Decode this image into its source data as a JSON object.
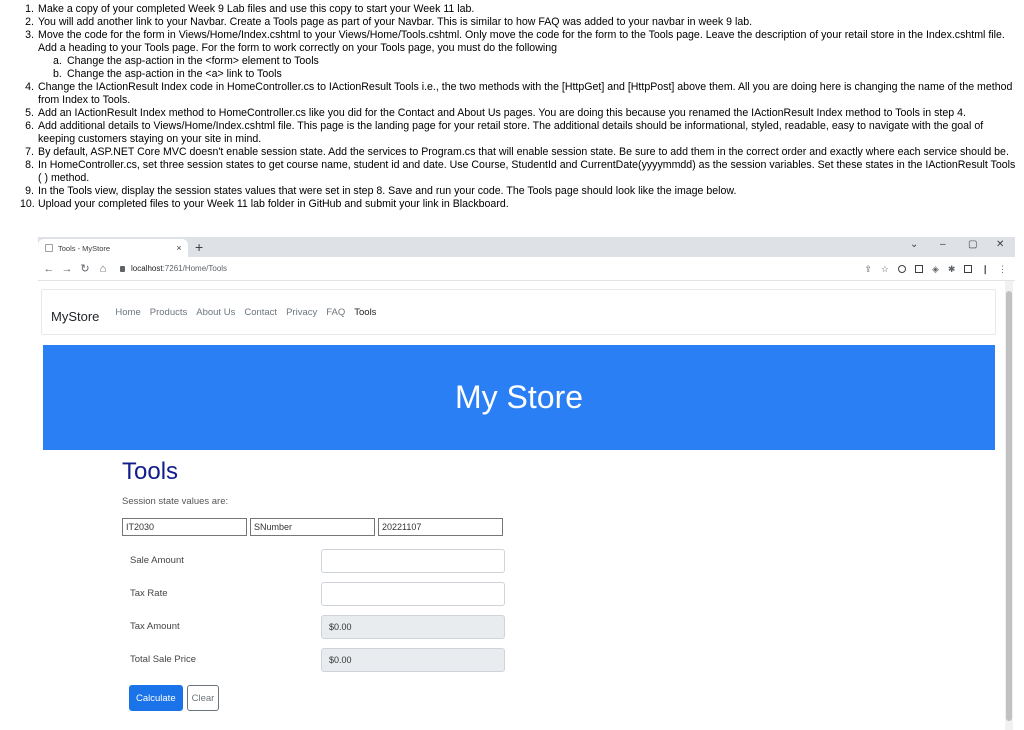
{
  "instructions": [
    {
      "num": "1.",
      "text": "Make a copy of your completed Week 9 Lab files and use this copy to start your Week 11 lab."
    },
    {
      "num": "2.",
      "text": "You will add another link to your Navbar. Create a Tools page as part of your Navbar. This is similar to how FAQ was added to your navbar in week 9 lab."
    },
    {
      "num": "3.",
      "text": "Move the code for the form in Views/Home/Index.cshtml to your Views/Home/Tools.cshtml. Only move the code for the form to the Tools page. Leave the description of your retail store in the Index.cshtml file. Add a heading to your Tools page. For the form to work correctly on your Tools page, you must do the following"
    },
    {
      "num": "a.",
      "text": "Change the asp-action in the <form> element to Tools",
      "sub": true
    },
    {
      "num": "b.",
      "text": "Change the asp-action in the <a> link to Tools",
      "sub": true
    },
    {
      "num": "4.",
      "text": "Change the IActionResult Index code in HomeController.cs to IActionResult Tools i.e., the two methods with the [HttpGet] and [HttpPost] above them. All you are doing here is changing the name of the method from Index to Tools."
    },
    {
      "num": "5.",
      "text": "Add an IActionResult Index method to HomeController.cs like you did for the Contact and About Us pages. You are doing this because you renamed the IActionResult Index method to Tools in step 4."
    },
    {
      "num": "6.",
      "text": "Add additional details to Views/Home/Index.cshtml file. This page is the landing page for your retail store. The additional details should be informational, styled, readable, easy to navigate with the goal of keeping customers staying on your site in mind."
    },
    {
      "num": "7.",
      "text": "By default, ASP.NET Core MVC doesn't enable session state. Add the services to Program.cs that will enable session state. Be sure to add them in the correct order and exactly where each service should be."
    },
    {
      "num": "8.",
      "text": "In HomeController.cs, set three session states to get course name, student id and date. Use Course, StudentId and CurrentDate(yyyymmdd) as the session variables. Set these states in the IActionResult Tools ( ) method."
    },
    {
      "num": "9.",
      "text": "In the Tools view, display the session states values that were set in step 8. Save and run your code. The Tools page should look like the image below."
    },
    {
      "num": "10.",
      "text": "Upload your completed files to your Week 11 lab folder in GitHub and submit your link in Blackboard."
    }
  ],
  "browser": {
    "tab_title": "Tools - MyStore",
    "tab_close": "×",
    "new_tab": "+",
    "url_host": "localhost",
    "url_path": ":7261/Home/Tools",
    "controls": {
      "dropdown": "⌄",
      "minimize": "–",
      "maximize": "▢",
      "close": "✕"
    }
  },
  "site": {
    "brand": "MyStore",
    "nav": [
      "Home",
      "Products",
      "About Us",
      "Contact",
      "Privacy",
      "FAQ",
      "Tools"
    ],
    "banner_title": "My Store",
    "page_title": "Tools",
    "session_label": "Session state values are:",
    "session_values": [
      "IT2030",
      "SNumber",
      "20221107"
    ],
    "form": {
      "sale_amount_label": "Sale Amount",
      "tax_rate_label": "Tax Rate",
      "tax_amount_label": "Tax Amount",
      "tax_amount_value": "$0.00",
      "total_label": "Total Sale Price",
      "total_value": "$0.00",
      "calculate_label": "Calculate",
      "clear_label": "Clear"
    }
  }
}
